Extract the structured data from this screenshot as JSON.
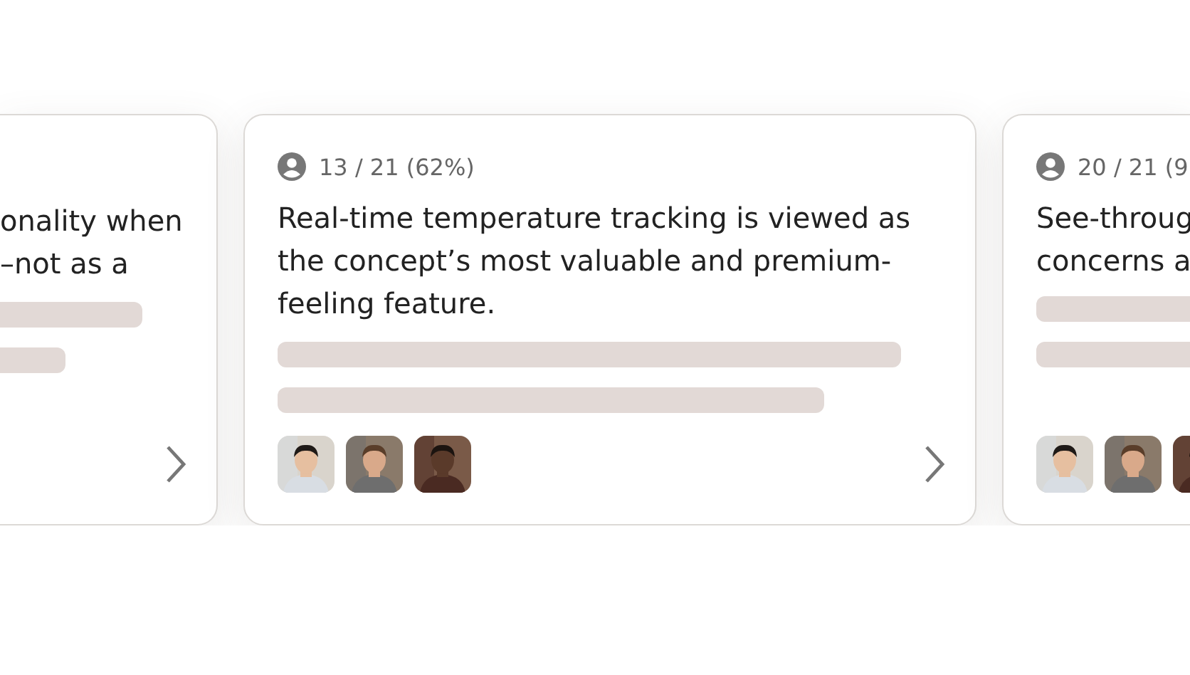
{
  "cards": [
    {
      "kind": "clipped-left",
      "lines": [
        "onality when",
        "–not as a"
      ],
      "chevron": true
    },
    {
      "kind": "full",
      "count": "13 / 21 (62%)",
      "text": "Real-time temperature tracking is viewed as the concept’s most valuable and premium-feeling feature.",
      "avatars": [
        {
          "kind": "picture"
        },
        {
          "kind": "picture"
        },
        {
          "kind": "picture"
        }
      ],
      "chevron": true
    },
    {
      "kind": "clipped-right",
      "count": "20 / 21 (9",
      "lines": [
        "See-throug",
        "concerns a"
      ],
      "avatars": [
        {
          "kind": "picture"
        },
        {
          "kind": "picture"
        },
        {
          "kind": "picture"
        }
      ],
      "chevron": false
    }
  ]
}
